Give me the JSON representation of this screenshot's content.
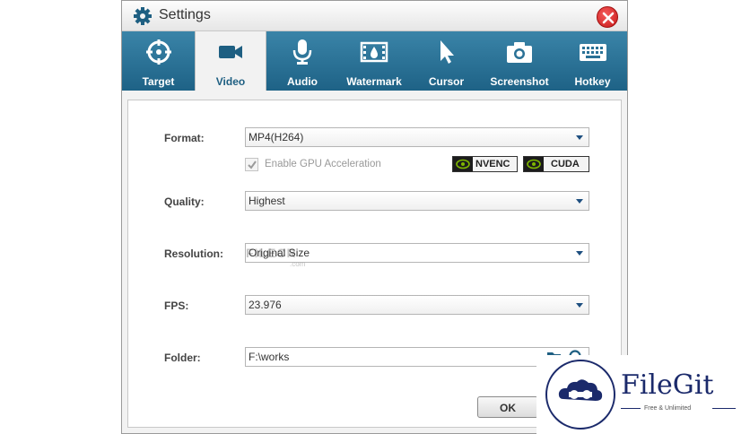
{
  "window": {
    "title": "Settings"
  },
  "tabs": [
    {
      "label": "Target",
      "icon": "target-icon"
    },
    {
      "label": "Video",
      "icon": "video-camera-icon",
      "active": true
    },
    {
      "label": "Audio",
      "icon": "microphone-icon"
    },
    {
      "label": "Watermark",
      "icon": "film-icon"
    },
    {
      "label": "Cursor",
      "icon": "cursor-icon"
    },
    {
      "label": "Screenshot",
      "icon": "camera-icon"
    },
    {
      "label": "Hotkey",
      "icon": "keyboard-icon"
    }
  ],
  "form": {
    "format": {
      "label": "Format:",
      "value": "MP4(H264)"
    },
    "gpu": {
      "label": "Enable GPU Acceleration",
      "checked": true,
      "enabled": false
    },
    "badges": {
      "nvenc": "NVENC",
      "cuda": "CUDA"
    },
    "quality": {
      "label": "Quality:",
      "value": "Highest"
    },
    "resolution": {
      "label": "Resolution:",
      "value": "Original Size"
    },
    "fps": {
      "label": "FPS:",
      "value": "23.976"
    },
    "folder": {
      "label": "Folder:",
      "value": "F:\\works"
    }
  },
  "ok_label": "OK",
  "watermark": {
    "text": "FILECR",
    "sub": ".com"
  },
  "logo": {
    "name": "FileGit",
    "tagline": "Free & Unlimited"
  },
  "colors": {
    "accent": "#1e6286",
    "logo": "#1b2a6b",
    "close": "#d42a2a"
  }
}
